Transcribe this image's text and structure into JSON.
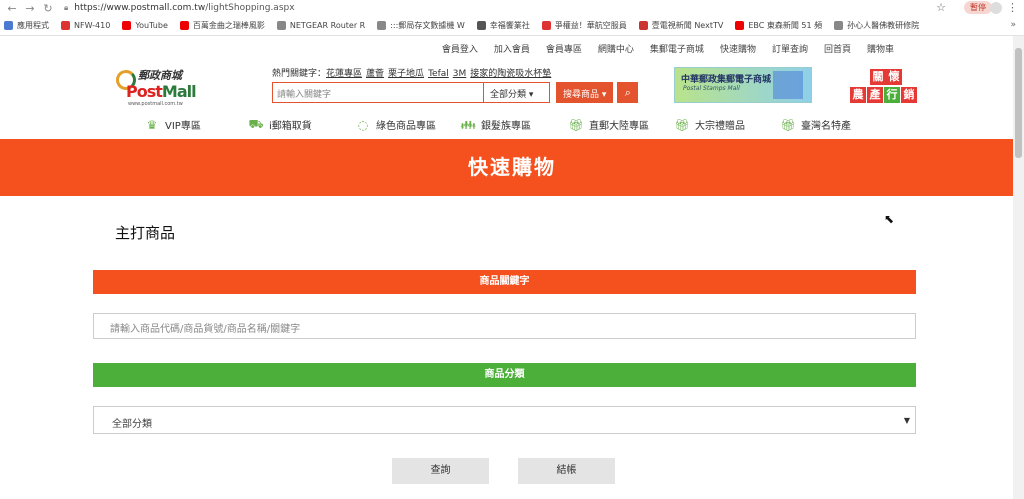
{
  "browser": {
    "url_host": "https://www.postmall.com.tw",
    "url_path": "/lightShopping.aspx",
    "profile_label": "暫停",
    "bookmarks": [
      {
        "label": "應用程式",
        "color": "#4a7bd0"
      },
      {
        "label": "NFW-410",
        "color": "#d33"
      },
      {
        "label": "YouTube",
        "color": "#e00"
      },
      {
        "label": "百萬金曲之瑞棒風影",
        "color": "#e00"
      },
      {
        "label": "NETGEAR Router R",
        "color": "#888"
      },
      {
        "label": ":::郵局存文數據機 W",
        "color": "#888"
      },
      {
        "label": "幸福饗業社",
        "color": "#555"
      },
      {
        "label": "爭權益！華航空服員",
        "color": "#d33"
      },
      {
        "label": "壹電視新聞 NextTV",
        "color": "#c33"
      },
      {
        "label": "EBC 東森新聞 51 頻",
        "color": "#e00"
      },
      {
        "label": "孙心人醫佛教研修院",
        "color": "#888"
      }
    ]
  },
  "topnav": [
    "會員登入",
    "加入會員",
    "會員專區",
    "網購中心",
    "集郵電子商城",
    "快速購物",
    "訂單查詢",
    "回首頁",
    "購物車"
  ],
  "logo": {
    "cn": "郵政商城",
    "en_a": "Post",
    "en_b": "Mall",
    "url": "www.postmall.com.tw"
  },
  "hot": {
    "label": "熱門關鍵字：",
    "items": [
      "花蓮專區",
      "蘆薈",
      "栗子地瓜",
      "Tefal",
      "3M",
      "接家的陶瓷吸水杯墊"
    ]
  },
  "search": {
    "placeholder": "請輸入關鍵字",
    "category": "全部分類 ▾",
    "button": "搜尋商品 ▾",
    "icon": "search-icon"
  },
  "banner1": {
    "title": "中華郵政集郵電子商城",
    "subtitle": "Postal Stamps Mall"
  },
  "banner2": {
    "cells": [
      "關",
      "懷",
      "農",
      "產",
      "行",
      "銷"
    ]
  },
  "catnav": [
    {
      "label": "VIP專區",
      "icon": "crown-icon"
    },
    {
      "label": "i郵箱取貨",
      "icon": "box-icon"
    },
    {
      "label": "綠色商品專區",
      "icon": "leaf-icon"
    },
    {
      "label": "銀髮族專區",
      "icon": "people-icon"
    },
    {
      "label": "直郵大陸專區",
      "icon": "gift-icon"
    },
    {
      "label": "大宗禮贈品",
      "icon": "gift-icon"
    },
    {
      "label": "臺灣名特產",
      "icon": "gift-icon"
    }
  ],
  "hero": {
    "title": "快速購物"
  },
  "main": {
    "title": "主打商品",
    "keyword_header": "商品關鍵字",
    "keyword_placeholder": "請輸入商品代碼/商品貨號/商品名稱/關鍵字",
    "category_header": "商品分類",
    "category_selected": "全部分類",
    "query_button": "查詢",
    "checkout_button": "結帳"
  },
  "colors": {
    "brand": "#f4511e",
    "green": "#4caf3a"
  }
}
